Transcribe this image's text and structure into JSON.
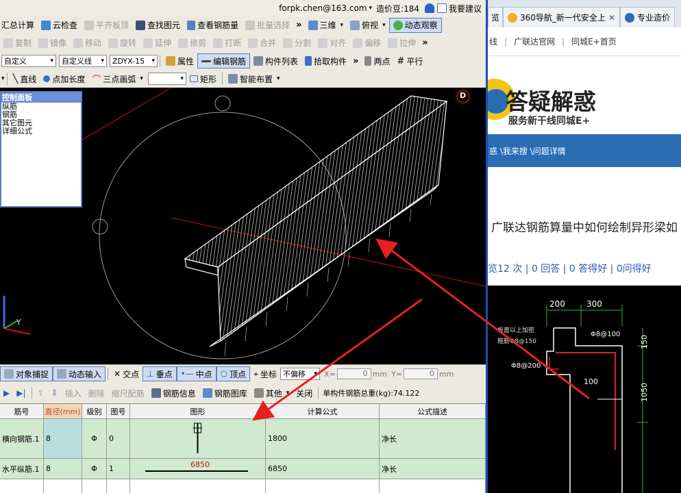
{
  "app": {
    "account": {
      "email": "forpk.chen@163.com",
      "balance_label": "造价豆:184",
      "feedback_label": "我要建议"
    },
    "row1": {
      "summary_label": "汇总计算",
      "cloud_check_label": "云检查",
      "flush_label": "平齐板顶",
      "find_label": "查找图元",
      "view_rebar_label": "查看钢筋量",
      "batch_select_label": "批量选择",
      "view_mode": "三维",
      "view_dir": "俯视",
      "dynamic_view_label": "动态观察"
    },
    "row2": {
      "items": [
        "复制",
        "镜像",
        "移动",
        "旋转",
        "延伸",
        "修剪",
        "打断",
        "合并",
        "分割",
        "对齐",
        "偏移",
        "拉伸"
      ]
    },
    "row3": {
      "combo1": "自定义",
      "combo2": "自定义线",
      "combo3": "ZDYX-15",
      "props_label": "属性",
      "edit_rebar_label": "编辑钢筋",
      "component_list_label": "构件列表",
      "pick_component_label": "拾取构件",
      "two_points_label": "两点",
      "parallel_label": "平行"
    },
    "row4": {
      "line_label": "直线",
      "point_length_label": "点加长度",
      "arc_label": "三点画弧",
      "rect_label": "矩形",
      "smart_layout_label": "智能布置"
    },
    "viewport": {
      "panel_title": "控制面板",
      "panel_items": [
        "纵筋",
        "钢筋",
        "其它图元",
        "详细公式"
      ],
      "corner_letter": "D",
      "axis_y": "Y"
    },
    "snap": {
      "object_snap_label": "对象捕捉",
      "dynamic_input_label": "动态输入",
      "intersection_label": "交点",
      "perpendicular_label": "垂点",
      "midpoint_label": "中点",
      "vertex_label": "顶点",
      "coordinate_label": "坐标",
      "offset_mode": "不偏移",
      "x_label": "X=",
      "x_value": "0",
      "y_label": "Y=",
      "y_value": "0",
      "unit": "mm"
    },
    "rebar_bar": {
      "insert_label": "插入",
      "delete_label": "删除",
      "scale_label": "缩尺配筋",
      "info_label": "钢筋信息",
      "library_label": "钢筋图库",
      "other_label": "其他",
      "close_label": "关闭",
      "total_weight": "单构件钢筋总重(kg):74.122"
    },
    "table": {
      "headers": [
        "筋号",
        "直径(mm)",
        "级别",
        "图号",
        "图形",
        "计算公式",
        "公式描述"
      ],
      "rows": [
        {
          "name": "横向钢筋.1",
          "dia": "8",
          "grade": "Φ",
          "fig": "0",
          "formula": "1800",
          "desc": "净长"
        },
        {
          "name": "水平纵筋.1",
          "dia": "8",
          "grade": "Φ",
          "fig": "1",
          "shape_label": "6850",
          "formula": "6850",
          "desc": "净长"
        }
      ]
    }
  },
  "browser": {
    "tabs": [
      {
        "label": "览"
      },
      {
        "label": "360导航_新一代安全上"
      },
      {
        "label": "专业造价"
      }
    ],
    "favs": [
      "线",
      "广联达官网",
      "同城E+首页"
    ],
    "banner_title": "答疑解惑",
    "banner_sub": "服务新干线同城E+",
    "breadcrumb": "惑 \\我来搜 \\问题详情",
    "question": "广联达钢筋算量中如何绘制异形梁如",
    "stats": "览12 次 | 0 回答 | 0 答得好 | 0问得好",
    "drawing": {
      "dim1": "200",
      "dim2": "300",
      "label_a": "Φ8@100",
      "label_b": "Φ8@200",
      "dim_inner": "100",
      "dim_v1": "150",
      "dim_v2": "1050",
      "note1": "板面以上加密",
      "note2": "箍筋Φ8@150"
    }
  },
  "colors": {
    "arrow": "#e82020",
    "frame_blue": "#1a4fb0",
    "highlight_green": "#cfeacf"
  }
}
